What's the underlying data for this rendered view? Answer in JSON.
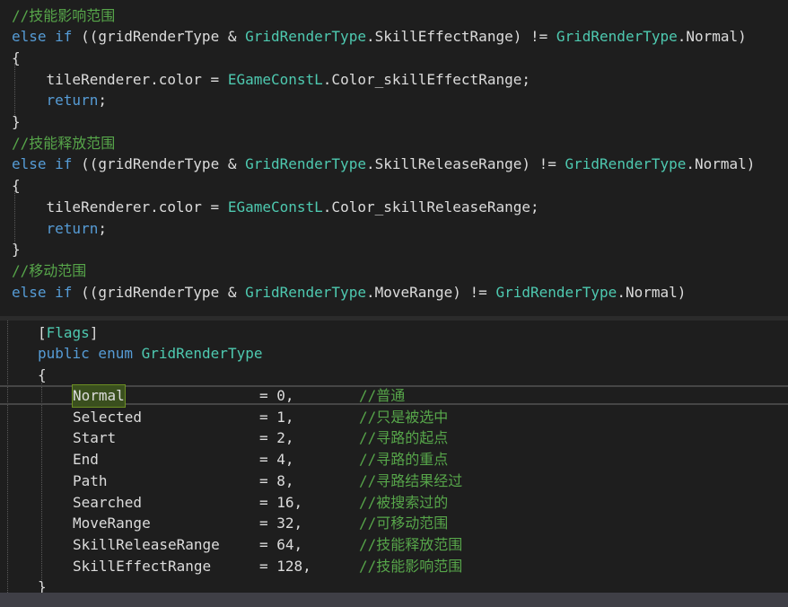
{
  "top_code": [
    {
      "tokens": [
        {
          "t": "//技能影响范围",
          "c": "cm"
        }
      ]
    },
    {
      "tokens": [
        {
          "t": "else if",
          "c": "kw"
        },
        {
          "t": " ((gridRenderType & ",
          "c": "pl"
        },
        {
          "t": "GridRenderType",
          "c": "ty"
        },
        {
          "t": ".SkillEffectRange) != ",
          "c": "pl"
        },
        {
          "t": "GridRenderType",
          "c": "ty"
        },
        {
          "t": ".Normal)",
          "c": "pl"
        }
      ]
    },
    {
      "tokens": [
        {
          "t": "{",
          "c": "pl"
        }
      ]
    },
    {
      "tokens": [
        {
          "t": "    tileRenderer.color = ",
          "c": "pl"
        },
        {
          "t": "EGameConstL",
          "c": "ty"
        },
        {
          "t": ".Color_skillEffectRange;",
          "c": "pl"
        }
      ]
    },
    {
      "tokens": [
        {
          "t": "    ",
          "c": "pl"
        },
        {
          "t": "return",
          "c": "kw"
        },
        {
          "t": ";",
          "c": "pl"
        }
      ]
    },
    {
      "tokens": [
        {
          "t": "}",
          "c": "pl"
        }
      ]
    },
    {
      "tokens": [
        {
          "t": "//技能释放范围",
          "c": "cm"
        }
      ]
    },
    {
      "tokens": [
        {
          "t": "else if",
          "c": "kw"
        },
        {
          "t": " ((gridRenderType & ",
          "c": "pl"
        },
        {
          "t": "GridRenderType",
          "c": "ty"
        },
        {
          "t": ".SkillReleaseRange) != ",
          "c": "pl"
        },
        {
          "t": "GridRenderType",
          "c": "ty"
        },
        {
          "t": ".Normal)",
          "c": "pl"
        }
      ]
    },
    {
      "tokens": [
        {
          "t": "{",
          "c": "pl"
        }
      ]
    },
    {
      "tokens": [
        {
          "t": "    tileRenderer.color = ",
          "c": "pl"
        },
        {
          "t": "EGameConstL",
          "c": "ty"
        },
        {
          "t": ".Color_skillReleaseRange;",
          "c": "pl"
        }
      ]
    },
    {
      "tokens": [
        {
          "t": "    ",
          "c": "pl"
        },
        {
          "t": "return",
          "c": "kw"
        },
        {
          "t": ";",
          "c": "pl"
        }
      ]
    },
    {
      "tokens": [
        {
          "t": "}",
          "c": "pl"
        }
      ]
    },
    {
      "tokens": [
        {
          "t": "//移动范围",
          "c": "cm"
        }
      ]
    },
    {
      "tokens": [
        {
          "t": "else if",
          "c": "kw"
        },
        {
          "t": " ((gridRenderType & ",
          "c": "pl"
        },
        {
          "t": "GridRenderType",
          "c": "ty"
        },
        {
          "t": ".MoveRange) != ",
          "c": "pl"
        },
        {
          "t": "GridRenderType",
          "c": "ty"
        },
        {
          "t": ".Normal)",
          "c": "pl"
        }
      ]
    }
  ],
  "bottom_code": {
    "attribute": [
      {
        "t": "[",
        "c": "pl"
      },
      {
        "t": "Flags",
        "c": "ty"
      },
      {
        "t": "]",
        "c": "pl"
      }
    ],
    "declaration": [
      {
        "t": "public enum",
        "c": "kw"
      },
      {
        "t": " ",
        "c": "pl"
      },
      {
        "t": "GridRenderType",
        "c": "ty"
      }
    ],
    "open_brace": "{",
    "close_brace": "}",
    "members": [
      {
        "name": "Normal",
        "value": "= 0,",
        "comment": "//普通",
        "highlighted": true
      },
      {
        "name": "Selected",
        "value": "= 1,",
        "comment": "//只是被选中"
      },
      {
        "name": "Start",
        "value": "= 2,",
        "comment": "//寻路的起点"
      },
      {
        "name": "End",
        "value": "= 4,",
        "comment": "//寻路的重点"
      },
      {
        "name": "Path",
        "value": "= 8,",
        "comment": "//寻路结果经过"
      },
      {
        "name": "Searched",
        "value": "= 16,",
        "comment": "//被搜索过的"
      },
      {
        "name": "MoveRange",
        "value": "= 32,",
        "comment": "//可移动范围"
      },
      {
        "name": "SkillReleaseRange",
        "value": "= 64,",
        "comment": "//技能释放范围"
      },
      {
        "name": "SkillEffectRange",
        "value": "= 128,",
        "comment": "//技能影响范围"
      }
    ]
  },
  "colors": {
    "background": "#1e1e1e",
    "keyword": "#569cd6",
    "type": "#4ec9b0",
    "comment": "#57a64a",
    "plain": "#dcdcdc",
    "highlight": "#3a4f1e"
  }
}
